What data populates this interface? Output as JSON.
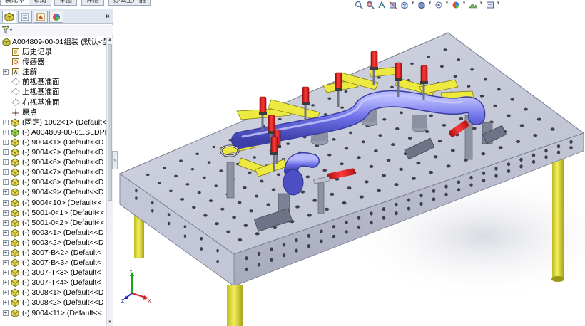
{
  "command_tabs": [
    {
      "label": "装配体",
      "active": true
    },
    {
      "label": "布局",
      "active": false
    },
    {
      "label": "草图",
      "active": false
    },
    {
      "label": "评估",
      "active": false
    },
    {
      "label": "办公室产品",
      "active": false
    }
  ],
  "hud_toolbar": [
    "zoom-to-fit-icon",
    "zoom-to-area-icon",
    "previous-view-icon",
    "section-view-icon",
    "view-orientation-icon",
    "display-style-icon",
    "hide-show-icon",
    "edit-appearance-icon",
    "apply-scene-icon",
    "view-settings-icon"
  ],
  "panel": {
    "tabs": [
      {
        "name": "feature-manager-tab",
        "icon": "assembly-tree-icon",
        "active": true
      },
      {
        "name": "property-manager-tab",
        "icon": "property-icon",
        "active": false
      },
      {
        "name": "configuration-manager-tab",
        "icon": "configuration-icon",
        "active": false
      },
      {
        "name": "display-manager-tab",
        "icon": "display-icon",
        "active": false
      }
    ],
    "more_label": "»",
    "filter_caret": "▾",
    "root": {
      "label": "A004809-00-01组装  (默认<显",
      "icon": "assembly-icon"
    },
    "items": [
      {
        "label": "历史记录",
        "icon": "history-icon",
        "expander": ""
      },
      {
        "label": "传感器",
        "icon": "sensor-icon",
        "expander": ""
      },
      {
        "label": "注解",
        "icon": "annotation-icon",
        "expander": "+"
      },
      {
        "label": "前视基准面",
        "icon": "plane-icon",
        "expander": ""
      },
      {
        "label": "上视基准面",
        "icon": "plane-icon",
        "expander": ""
      },
      {
        "label": "右视基准面",
        "icon": "plane-icon",
        "expander": ""
      },
      {
        "label": "原点",
        "icon": "origin-icon",
        "expander": ""
      },
      {
        "label": "(固定) 1002<1> (Default<",
        "icon": "part-icon",
        "expander": "+"
      },
      {
        "label": "(-) A004809-00-01.SLDPR",
        "icon": "subassembly-icon",
        "expander": "+"
      },
      {
        "label": "(-) 9004<1> (Default<<D",
        "icon": "part-icon",
        "expander": "+"
      },
      {
        "label": "(-) 9004<2> (Default<<D",
        "icon": "part-icon",
        "expander": "+"
      },
      {
        "label": "(-) 9004<6> (Default<<D",
        "icon": "part-icon",
        "expander": "+"
      },
      {
        "label": "(-) 9004<7> (Default<<D",
        "icon": "part-icon",
        "expander": "+"
      },
      {
        "label": "(-) 9004<8> (Default<<D",
        "icon": "part-icon",
        "expander": "+"
      },
      {
        "label": "(-) 9004<9> (Default<<D",
        "icon": "part-icon",
        "expander": "+"
      },
      {
        "label": "(-) 9004<10> (Default<<",
        "icon": "part-icon",
        "expander": "+"
      },
      {
        "label": "(-) 5001-0<1> (Default<<",
        "icon": "part-icon",
        "expander": "+"
      },
      {
        "label": "(-) 5001-0<2> (Default<<",
        "icon": "part-icon",
        "expander": "+"
      },
      {
        "label": "(-) 9003<1> (Default<<D",
        "icon": "part-icon",
        "expander": "+"
      },
      {
        "label": "(-) 9003<2> (Default<<D",
        "icon": "part-icon",
        "expander": "+"
      },
      {
        "label": "(-) 3007-B<2> (Default<",
        "icon": "part-icon",
        "expander": "+"
      },
      {
        "label": "(-) 3007-B<3> (Default<",
        "icon": "part-icon",
        "expander": "+"
      },
      {
        "label": "(-) 3007-T<3> (Default<",
        "icon": "part-icon",
        "expander": "+"
      },
      {
        "label": "(-) 3007-T<4> (Default<",
        "icon": "part-icon",
        "expander": "+"
      },
      {
        "label": "(-) 3008<1> (Default<<D",
        "icon": "part-icon",
        "expander": "+"
      },
      {
        "label": "(-) 3008<2> (Default<<D",
        "icon": "part-icon",
        "expander": "+"
      },
      {
        "label": "(-) 9004<11> (Default<<",
        "icon": "part-icon",
        "expander": "+"
      }
    ]
  },
  "splitter_label": "‹",
  "triad": {
    "x": "X",
    "y": "Y",
    "z": "Z"
  },
  "colors": {
    "table_top": "#c9ccd9",
    "table_side": "#b3b6c8",
    "legs": "#e6e13a",
    "clamp_red": "#e01818",
    "clamp_arm": "#ece940",
    "pipe": "#6d70e6",
    "panel_bg": "#ffffff"
  }
}
